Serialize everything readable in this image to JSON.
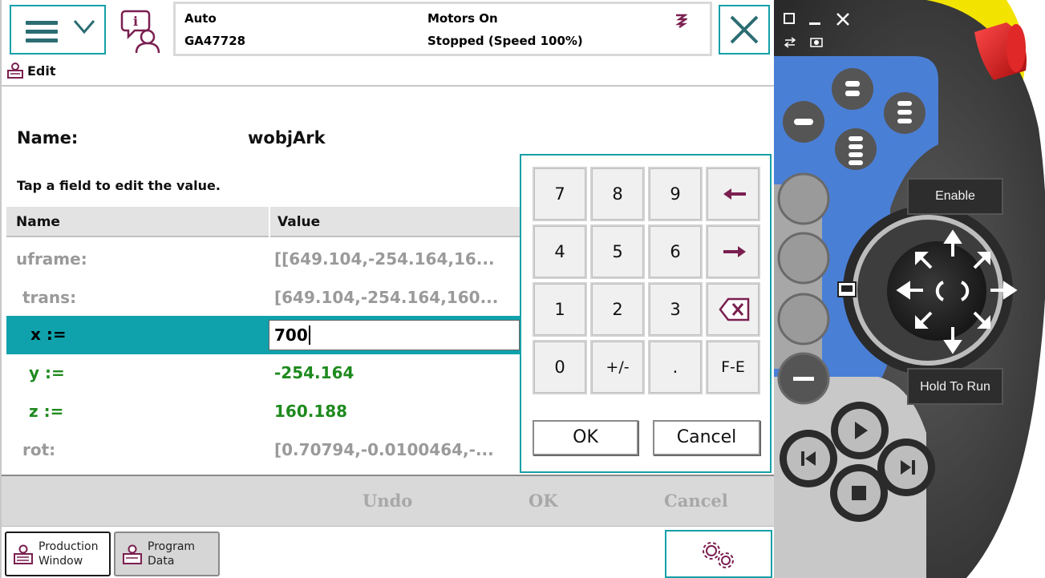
{
  "status": {
    "mode": "Auto",
    "controller": "GA47728",
    "motors": "Motors On",
    "state": "Stopped (Speed 100%)"
  },
  "edit": {
    "label": "Edit"
  },
  "name_row": {
    "label": "Name:",
    "value": "wobjArk"
  },
  "hint": "Tap a field to edit the value.",
  "table": {
    "headers": {
      "name": "Name",
      "value": "Value"
    },
    "rows": [
      {
        "name": "uframe:",
        "value": "[[649.104,-254.164,16..."
      },
      {
        "name": "trans:",
        "value": "[649.104,-254.164,160..."
      },
      {
        "name": "x :=",
        "value": "700"
      },
      {
        "name": "y :=",
        "value": "-254.164"
      },
      {
        "name": "z :=",
        "value": "160.188"
      },
      {
        "name": "rot:",
        "value": "[0.70794,-0.0100464,-..."
      }
    ]
  },
  "keypad": {
    "rows": [
      [
        "7",
        "8",
        "9",
        "left-arrow"
      ],
      [
        "4",
        "5",
        "6",
        "right-arrow"
      ],
      [
        "1",
        "2",
        "3",
        "backspace"
      ],
      [
        "0",
        "+/-",
        ".",
        "F-E"
      ]
    ],
    "ok": "OK",
    "cancel": "Cancel"
  },
  "actions": {
    "undo": "Undo",
    "ok": "OK",
    "cancel": "Cancel"
  },
  "taskbar": [
    {
      "line1": "Production",
      "line2": "Window"
    },
    {
      "line1": "Program",
      "line2": "Data"
    }
  ],
  "device": {
    "enable": "Enable",
    "hold_to_run": "Hold To Run"
  },
  "colors": {
    "accent": "#16a0a8",
    "selected_row": "#0fa2ac",
    "green_text": "#1e8a1e",
    "grey_text": "#9a9a9a",
    "device_blue": "#4a7fd6",
    "estop_red": "#d92020",
    "yellow": "#f2e400"
  }
}
